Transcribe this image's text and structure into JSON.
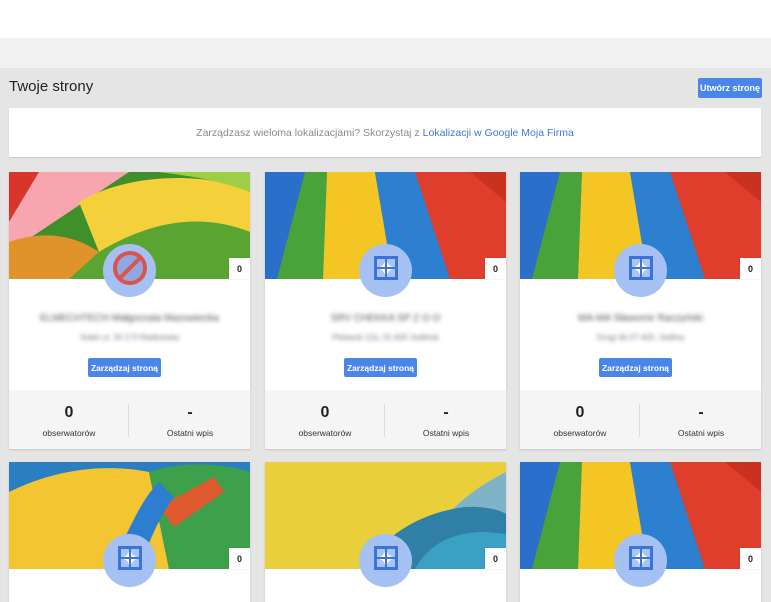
{
  "header": {
    "title": "Twoje strony",
    "create_label": "Utwórz stronę"
  },
  "promo": {
    "text": "Zarządzasz wieloma lokalizacjami? Skorzystaj z",
    "link": "Lokalizacji w Google Moja Firma"
  },
  "colors": {
    "accent": "#4a86e8",
    "link": "#4178d6",
    "background": "#e5e5e5"
  },
  "cards": [
    {
      "name": "ELMECHTECH Małgorzata Mazowiecka",
      "address": "Sołeh ul. 34 173 Radłowska",
      "badge": "0",
      "manage_label": "Zarządzaj stroną",
      "followers_count": "0",
      "followers_label": "obserwatorów",
      "last_post_value": "-",
      "last_post_label": "Ostatni wpis",
      "cover": "paper-yellow-green",
      "avatar": "no-entry-icon"
    },
    {
      "name": "SRV CHEKKA SP Z O O",
      "address": "Plebanik 12a, 01-600 Jedlińsk",
      "badge": "0",
      "manage_label": "Zarządzaj stroną",
      "followers_count": "0",
      "followers_label": "obserwatorów",
      "last_post_value": "-",
      "last_post_label": "Ostatni wpis",
      "cover": "stripes-green-yellow-blue-red",
      "avatar": "storefront-icon"
    },
    {
      "name": "MA-MA Sławomir Raczyński",
      "address": "Drogi 4b 07-400, Jedlina",
      "badge": "0",
      "manage_label": "Zarządzaj stroną",
      "followers_count": "0",
      "followers_label": "obserwatorów",
      "last_post_value": "-",
      "last_post_label": "Ostatni wpis",
      "cover": "stripes-green-yellow-blue-red",
      "avatar": "storefront-icon"
    },
    {
      "badge": "0",
      "cover": "paper-yellow-blue-red",
      "avatar": "storefront-icon"
    },
    {
      "badge": "0",
      "cover": "paper-yellow-teal",
      "avatar": "storefront-icon"
    },
    {
      "badge": "0",
      "cover": "stripes-green-yellow-blue-red",
      "avatar": "storefront-icon"
    }
  ]
}
